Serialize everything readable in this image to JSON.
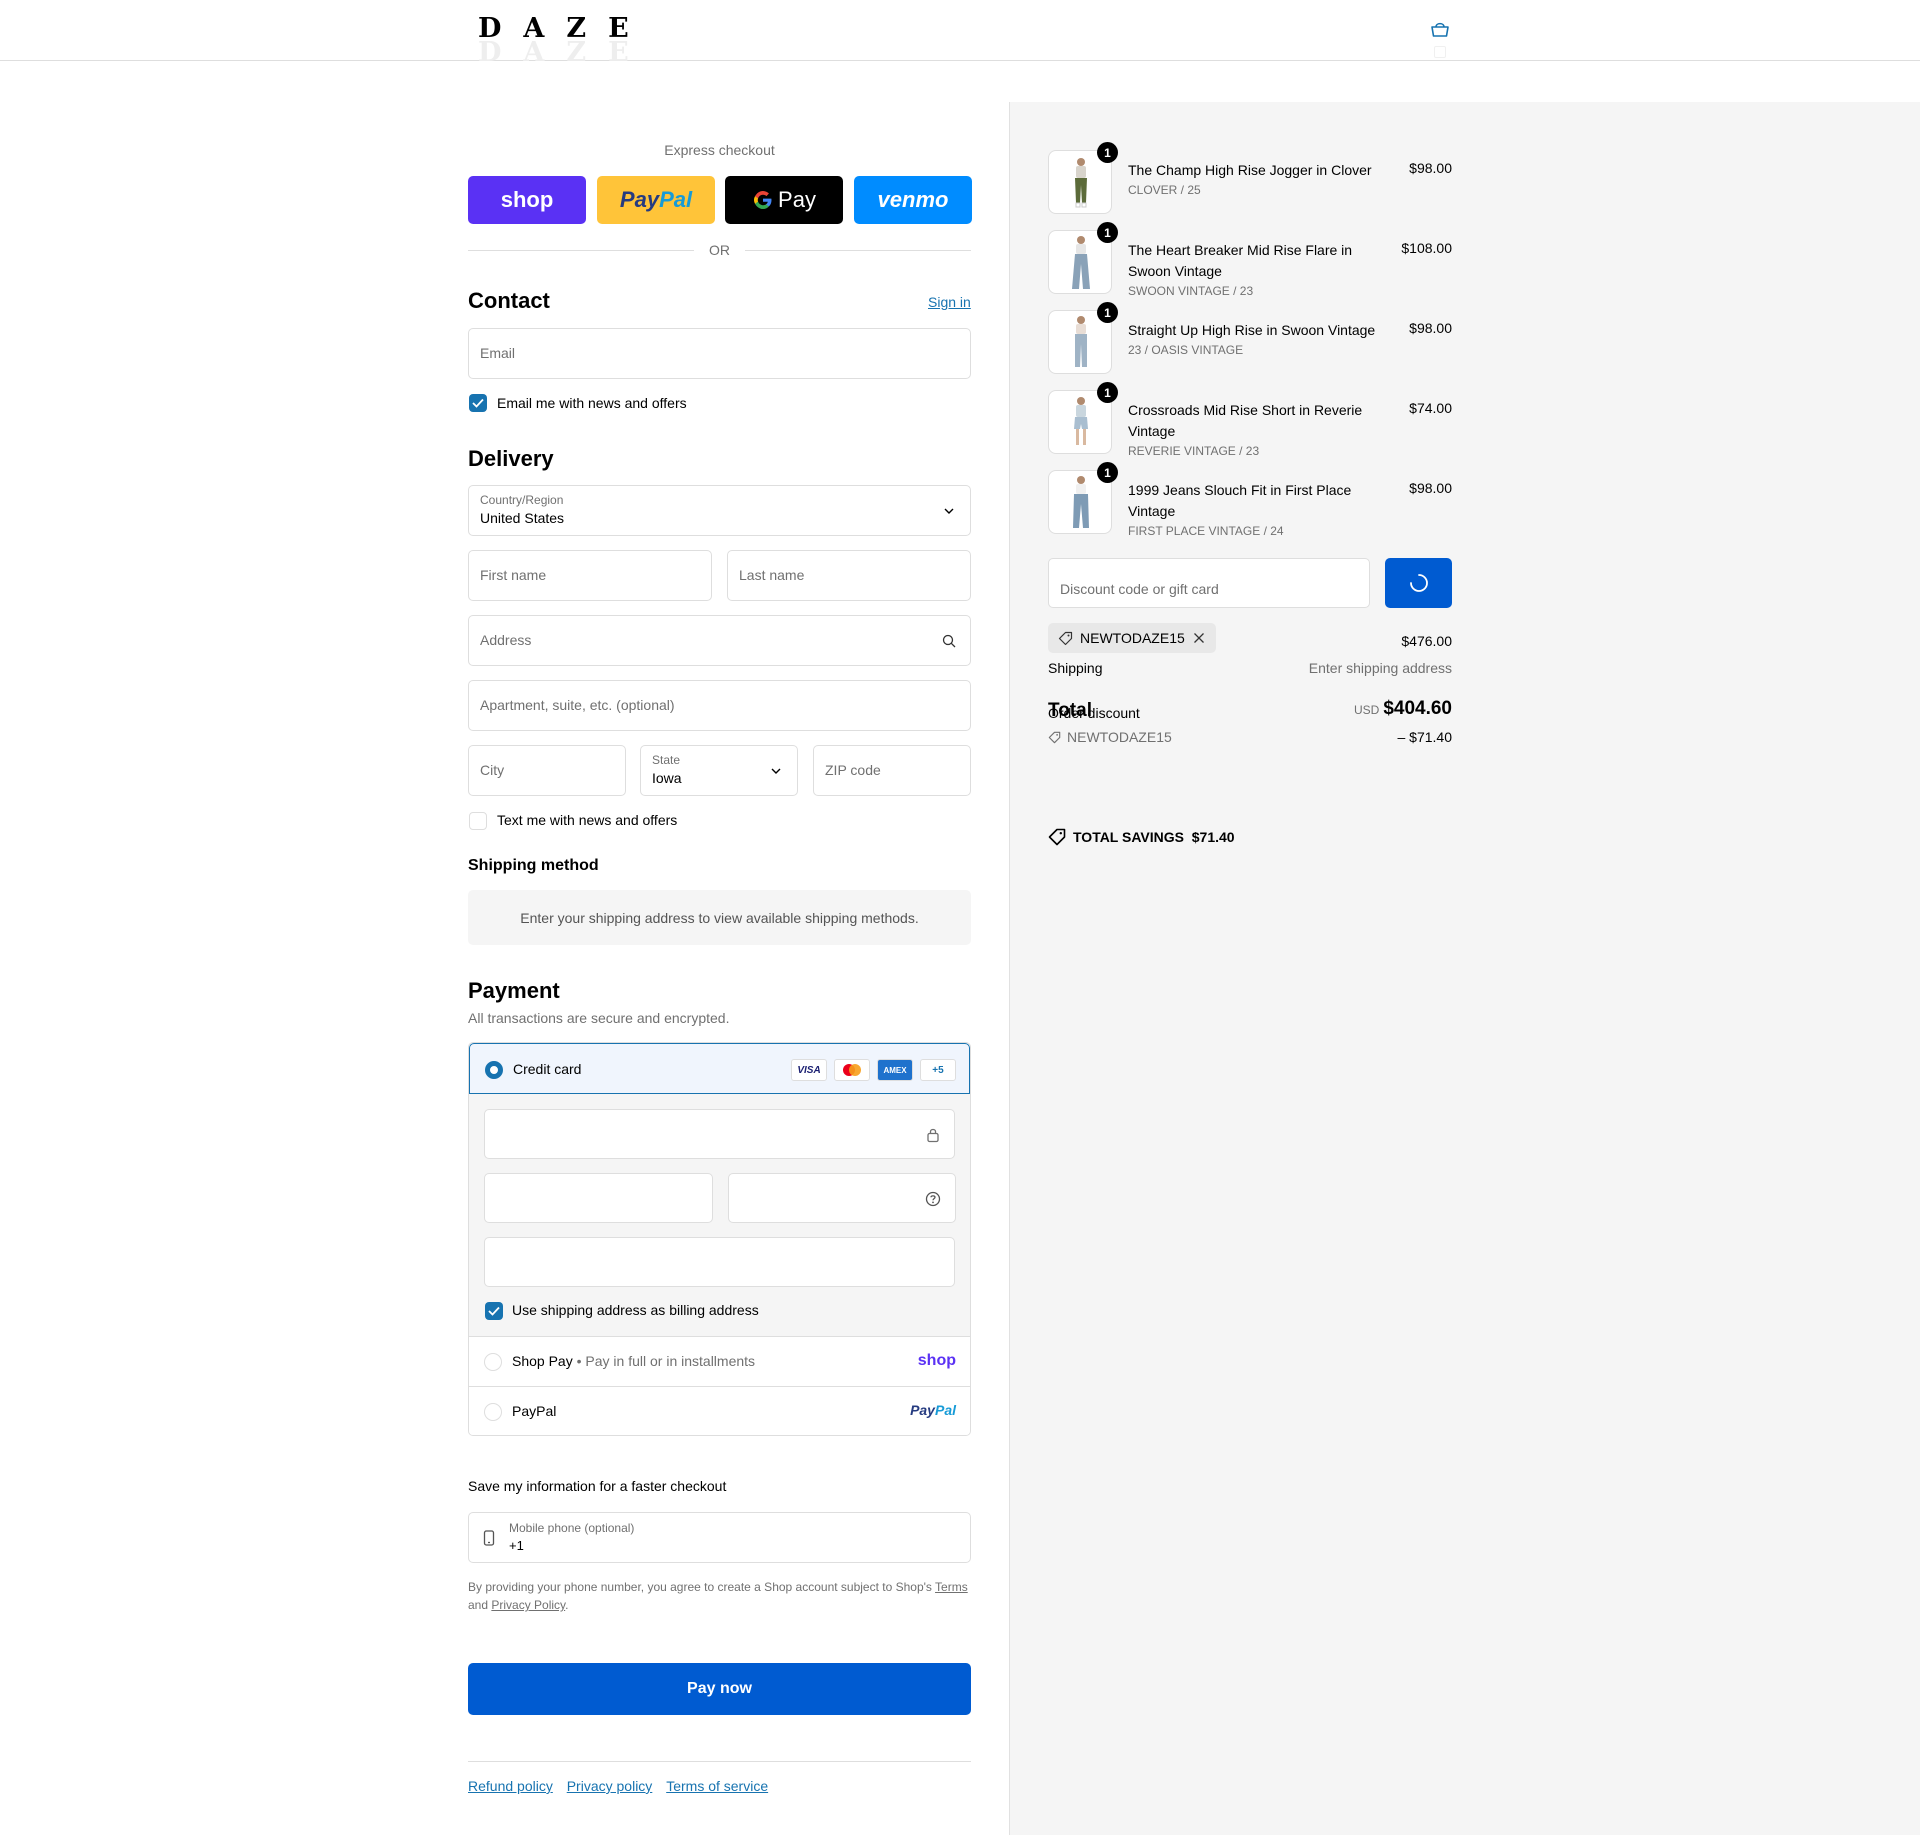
{
  "header": {
    "logo": "DAZE",
    "cart_icon": "cart-icon"
  },
  "express": {
    "title": "Express checkout",
    "shop": "shop",
    "paypal_a": "Pay",
    "paypal_b": "Pal",
    "gpay": "Pay",
    "venmo": "venmo",
    "or": "OR"
  },
  "contact": {
    "title": "Contact",
    "sign_in": "Sign in",
    "email_placeholder": "Email",
    "newsletter_label": "Email me with news and offers"
  },
  "delivery": {
    "title": "Delivery",
    "country_label": "Country/Region",
    "country_value": "United States",
    "first_name": "First name",
    "last_name": "Last name",
    "address": "Address",
    "apartment": "Apartment, suite, etc. (optional)",
    "city": "City",
    "state_label": "State",
    "state_value": "Iowa",
    "zip": "ZIP code",
    "sms_label": "Text me with news and offers"
  },
  "shipping_method": {
    "title": "Shipping method",
    "message": "Enter your shipping address to view available shipping methods."
  },
  "payment": {
    "title": "Payment",
    "subtitle": "All transactions are secure and encrypted.",
    "credit_card": "Credit card",
    "card_logos": [
      "VISA",
      "",
      "AMEX",
      "+5"
    ],
    "billing_label": "Use shipping address as billing address",
    "shop_pay": "Shop Pay",
    "shop_pay_sub": "Pay in full or in installments",
    "shop_logo": "shop",
    "paypal": "PayPal",
    "paypal_logo_a": "Pay",
    "paypal_logo_b": "Pal"
  },
  "save_info": {
    "title": "Save my information for a faster checkout",
    "phone_label": "Mobile phone (optional)",
    "phone_value": "+1",
    "legal_a": "By providing your phone number, you agree to create a Shop account subject to Shop's ",
    "legal_terms": "Terms",
    "legal_b": "and ",
    "legal_privacy": "Privacy Policy",
    "legal_c": "."
  },
  "pay_now": "Pay now",
  "footer": {
    "refund": "Refund policy",
    "privacy": "Privacy policy",
    "terms": "Terms of service"
  },
  "cart": {
    "items": [
      {
        "qty": "1",
        "name": "The Champ High Rise Jogger in Clover",
        "variant": "CLOVER / 25",
        "price": "$98.00"
      },
      {
        "qty": "1",
        "name": "The Heart Breaker Mid Rise Flare in Swoon Vintage",
        "variant": "SWOON VINTAGE / 23",
        "price": "$108.00"
      },
      {
        "qty": "1",
        "name": "Straight Up High Rise in Swoon Vintage",
        "variant": "23 / OASIS VINTAGE",
        "price": "$98.00"
      },
      {
        "qty": "1",
        "name": "Crossroads Mid Rise Short in Reverie Vintage",
        "variant": "REVERIE VINTAGE / 23",
        "price": "$74.00"
      },
      {
        "qty": "1",
        "name": "1999 Jeans Slouch Fit in First Place Vintage",
        "variant": "FIRST PLACE VINTAGE / 24",
        "price": "$98.00"
      }
    ],
    "discount_placeholder": "Discount code or gift card",
    "code": "NEWTODAZE15",
    "subtotal": "$476.00",
    "shipping_label": "Shipping",
    "shipping_value": "Enter shipping address",
    "total_label": "Total",
    "order_discount_label": "Order discount",
    "currency": "USD",
    "total": "$404.60",
    "discount_code": "NEWTODAZE15",
    "discount_amount": "– $71.40",
    "savings_label": "TOTAL SAVINGS",
    "savings_value": "$71.40"
  },
  "colors": {
    "accent": "#1773b0",
    "pay_button": "#005bd1",
    "shop_purple": "#5a31f4",
    "paypal_yellow": "#ffc439",
    "venmo_blue": "#008cff"
  }
}
